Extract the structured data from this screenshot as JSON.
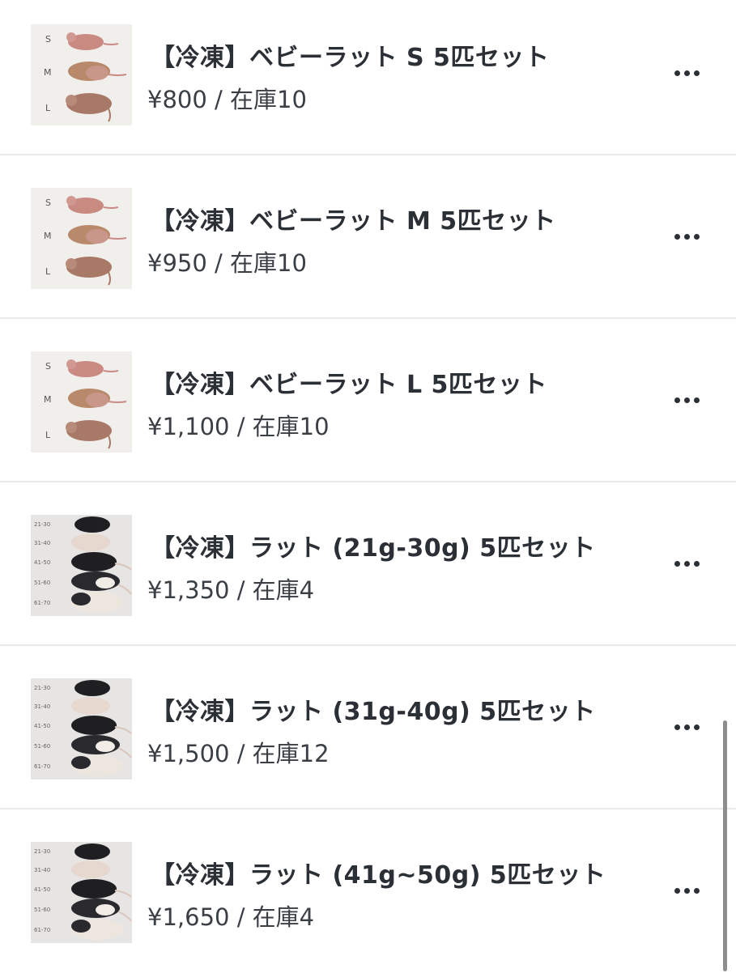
{
  "products": [
    {
      "title": "【冷凍】ベビーラット S 5匹セット",
      "price": "¥800 / 在庫10",
      "thumbnail": "baby-rat-sml-photo",
      "thumbnail_labels": [
        "S",
        "M",
        "L"
      ]
    },
    {
      "title": "【冷凍】ベビーラット M 5匹セット",
      "price": "¥950 / 在庫10",
      "thumbnail": "baby-rat-sml-photo",
      "thumbnail_labels": [
        "S",
        "M",
        "L"
      ]
    },
    {
      "title": "【冷凍】ベビーラット L 5匹セット",
      "price": "¥1,100 / 在庫10",
      "thumbnail": "baby-rat-sml-photo",
      "thumbnail_labels": [
        "S",
        "M",
        "L"
      ]
    },
    {
      "title": "【冷凍】ラット (21g-30g) 5匹セット",
      "price": "¥1,350 / 在庫4",
      "thumbnail": "rat-weight-chart-photo",
      "thumbnail_labels": [
        "21-30",
        "31-40",
        "41-50",
        "51-60",
        "61-70"
      ]
    },
    {
      "title": "【冷凍】ラット (31g-40g) 5匹セット",
      "price": "¥1,500 / 在庫12",
      "thumbnail": "rat-weight-chart-photo",
      "thumbnail_labels": [
        "21-30",
        "31-40",
        "41-50",
        "51-60",
        "61-70"
      ]
    },
    {
      "title": "【冷凍】ラット (41g~50g) 5匹セット",
      "price": "¥1,650 / 在庫4",
      "thumbnail": "rat-weight-chart-photo",
      "thumbnail_labels": [
        "21-30",
        "31-40",
        "41-50",
        "51-60",
        "61-70"
      ]
    }
  ],
  "menu_icon": "more-horizontal-icon",
  "colors": {
    "text": "#2b2f36",
    "divider": "#e9e9ec",
    "baby_rat": "#c98a82",
    "baby_rat_tan": "#b8896a",
    "rat_black": "#1f1f22",
    "rat_white": "#ece6de"
  }
}
